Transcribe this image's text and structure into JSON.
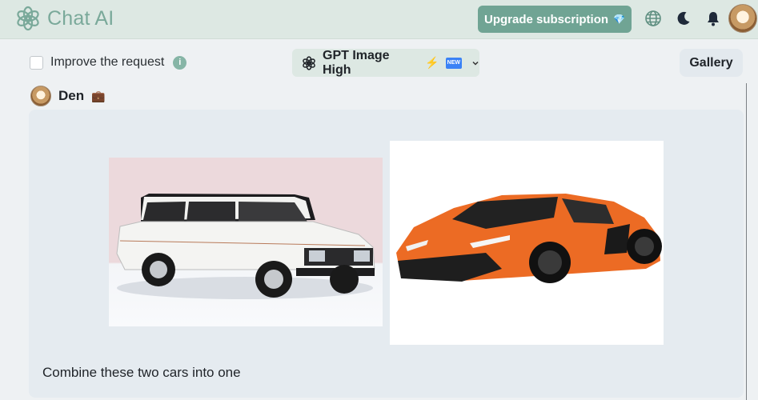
{
  "header": {
    "app_name": "Chat AI",
    "upgrade_label": "Upgrade subscription",
    "gem_glyph": "💎",
    "icons": [
      "openai-logo-icon",
      "globe-icon",
      "moon-icon",
      "bell-icon",
      "user-avatar"
    ]
  },
  "toolbar": {
    "improve_label": "Improve the request",
    "improve_checked": false,
    "info_glyph": "i",
    "model_label": "GPT Image High",
    "bolt_glyph": "⚡",
    "new_badge": "NEW",
    "gallery_label": "Gallery"
  },
  "message": {
    "user_name": "Den",
    "briefcase_glyph": "💼",
    "text": "Combine these two cars into one",
    "images": [
      "white-station-wagon-image",
      "orange-sports-car-image"
    ]
  },
  "colors": {
    "header_bg": "#dde8e3",
    "brand": "#7aa99a",
    "upgrade_bg": "#70a494",
    "card_bg": "#e5ebf0",
    "page_bg": "#eef1f3"
  }
}
